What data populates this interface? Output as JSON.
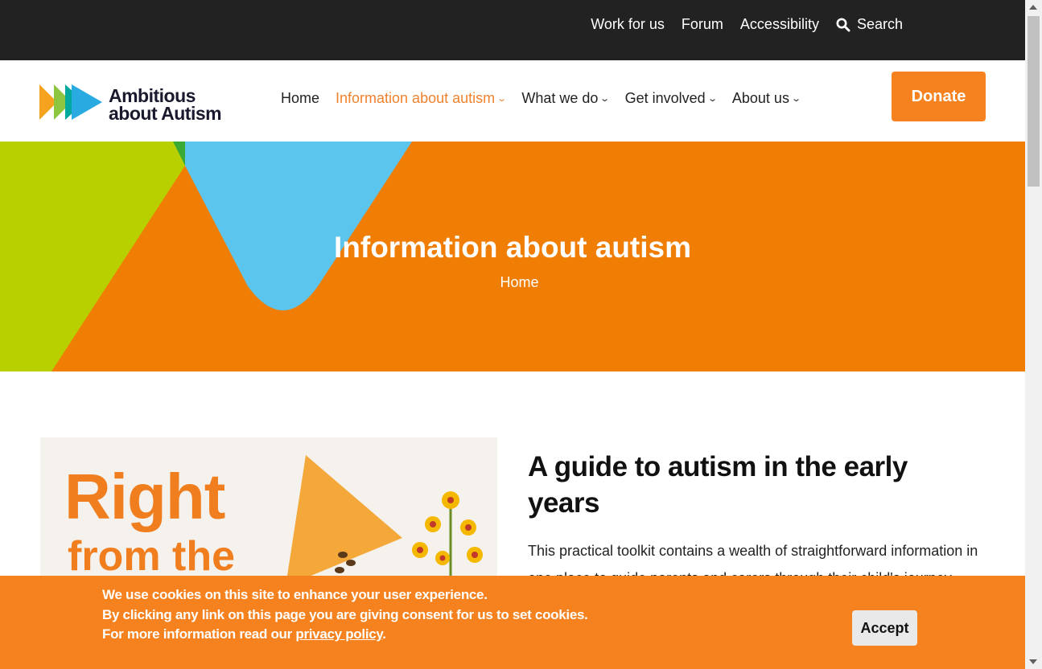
{
  "topbar": {
    "links": [
      "Work for us",
      "Forum",
      "Accessibility"
    ],
    "search_label": "Search",
    "search_icon": "search-icon"
  },
  "header": {
    "logo_line1": "Ambitious",
    "logo_line2": "about Autism",
    "nav": [
      {
        "label": "Home",
        "active": false
      },
      {
        "label": "Information about autism",
        "active": true
      },
      {
        "label": "What we do",
        "active": false
      },
      {
        "label": "Get involved",
        "active": false
      },
      {
        "label": "About us",
        "active": false
      }
    ],
    "donate_label": "Donate"
  },
  "hero": {
    "title": "Information about autism",
    "breadcrumb": "Home"
  },
  "card": {
    "image_text_line1": "Right",
    "image_text_line2": "from the"
  },
  "article": {
    "title": "A guide to autism in the early years",
    "body": "This practical toolkit contains a wealth of straightforward information in one place to guide parents and carers through their child's journey"
  },
  "cookie": {
    "line1": "We use cookies on this site to enhance your user experience.",
    "line2": "By clicking any link on this page you are giving consent for us to set cookies.",
    "line3_prefix": "For more information read our ",
    "line3_link": "privacy policy",
    "line3_suffix": ".",
    "accept_label": "Accept"
  },
  "colors": {
    "accent": "#f5821f",
    "hero_orange": "#f07e05",
    "hero_green": "#b8d000",
    "hero_blue": "#5bc5ee",
    "topbar": "#222222"
  }
}
